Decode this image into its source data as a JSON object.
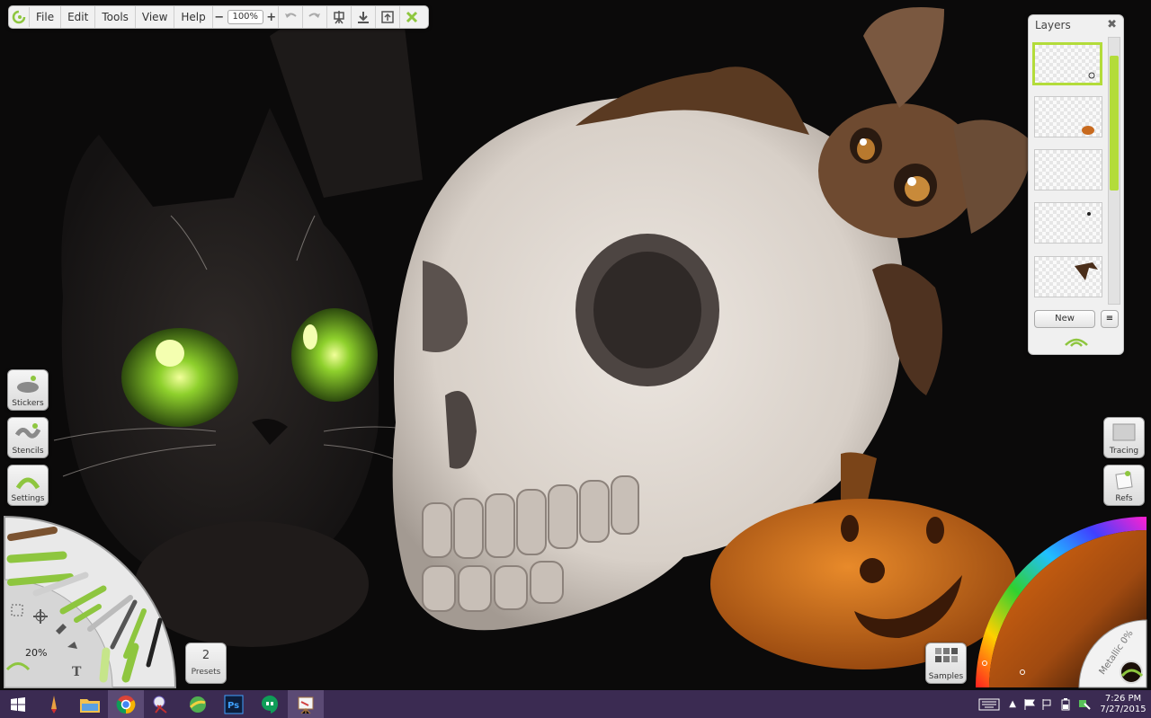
{
  "menubar": {
    "items": [
      "File",
      "Edit",
      "Tools",
      "View",
      "Help"
    ],
    "zoom_minus": "−",
    "zoom_value": "100%",
    "zoom_plus": "+"
  },
  "layers_panel": {
    "title": "Layers",
    "close": "✖",
    "new_button": "New",
    "options_button": "≡"
  },
  "left_buttons": {
    "stickers": "Stickers",
    "stencils": "Stencils",
    "settings": "Settings"
  },
  "tool_wheel": {
    "size": "20%"
  },
  "presets": {
    "count": "2",
    "label": "Presets"
  },
  "right_buttons": {
    "tracing": "Tracing",
    "refs": "Refs",
    "samples": "Samples"
  },
  "color_wheel": {
    "metallic": "Metallic 0%"
  },
  "taskbar": {
    "time": "7:26 PM",
    "date": "7/27/2015"
  },
  "colors": {
    "accent": "#b3dc3a",
    "taskbar": "#3b2b52",
    "canvas_bg": "#0b0a0a"
  }
}
